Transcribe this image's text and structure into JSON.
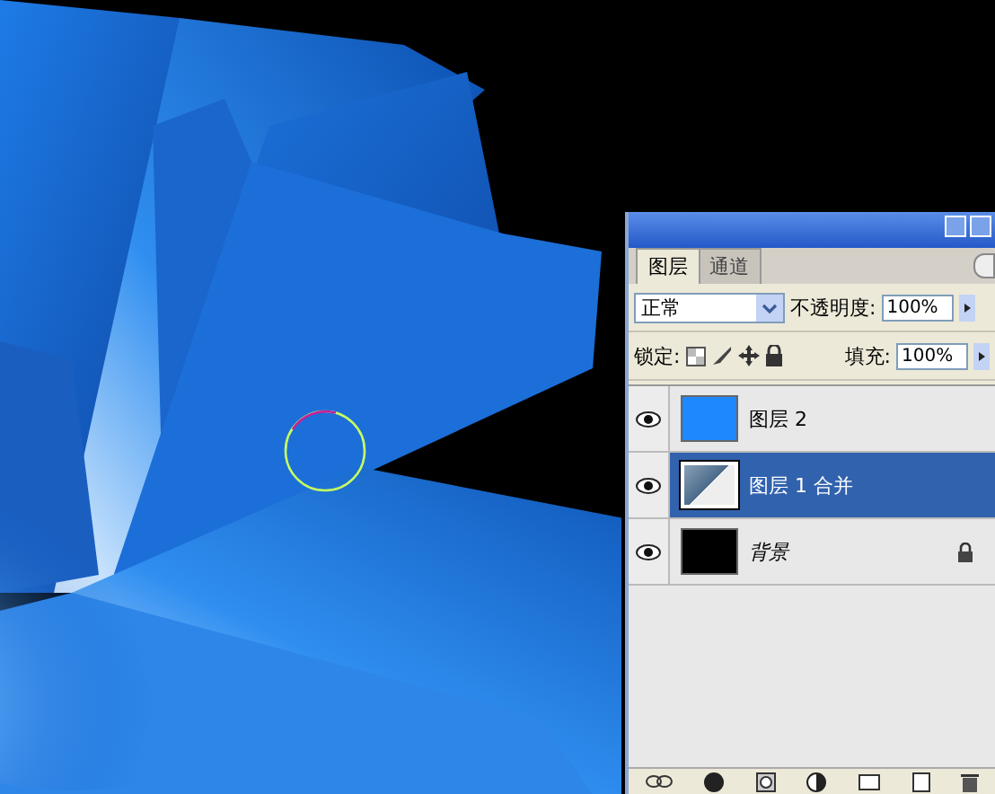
{
  "layers_panel": {
    "tabs": [
      {
        "label": "图层",
        "selected": true
      },
      {
        "label": "通道",
        "selected": false
      }
    ],
    "blend_mode": "正常",
    "opacity_label": "不透明度:",
    "opacity": "100%",
    "lock_label": "锁定:",
    "fill_label": "填充:",
    "fill": "100%",
    "layers": [
      {
        "name": "图层 2",
        "kind": "color",
        "visible": true,
        "selected": false,
        "locked": false
      },
      {
        "name": "图层 1 合并",
        "kind": "image",
        "visible": true,
        "selected": true,
        "locked": false
      },
      {
        "name": "背景",
        "kind": "black",
        "visible": true,
        "selected": false,
        "locked": true
      }
    ]
  }
}
